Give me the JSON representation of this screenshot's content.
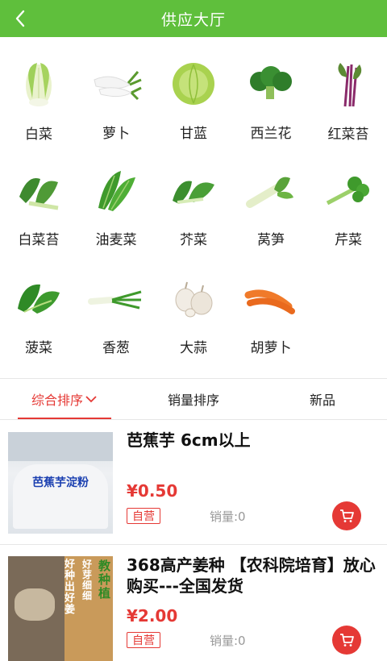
{
  "header": {
    "title": "供应大厅",
    "back_icon": "back-arrow-icon"
  },
  "categories": [
    {
      "name": "白菜",
      "icon": "napa-cabbage-icon"
    },
    {
      "name": "萝卜",
      "icon": "radish-icon"
    },
    {
      "name": "甘蓝",
      "icon": "cabbage-icon"
    },
    {
      "name": "西兰花",
      "icon": "broccoli-icon"
    },
    {
      "name": "红菜苔",
      "icon": "red-cabbage-stem-icon"
    },
    {
      "name": "白菜苔",
      "icon": "bok-choy-stem-icon"
    },
    {
      "name": "油麦菜",
      "icon": "lettuce-leaf-icon"
    },
    {
      "name": "芥菜",
      "icon": "mustard-greens-icon"
    },
    {
      "name": "莴笋",
      "icon": "celtuce-icon"
    },
    {
      "name": "芹菜",
      "icon": "celery-icon"
    },
    {
      "name": "菠菜",
      "icon": "spinach-icon"
    },
    {
      "name": "香葱",
      "icon": "scallion-icon"
    },
    {
      "name": "大蒜",
      "icon": "garlic-icon"
    },
    {
      "name": "胡萝卜",
      "icon": "carrot-icon"
    }
  ],
  "sort_tabs": [
    {
      "label": "综合排序",
      "active": true,
      "icon": "chevron-down-icon"
    },
    {
      "label": "销量排序",
      "active": false
    },
    {
      "label": "新品",
      "active": false
    }
  ],
  "products": [
    {
      "name": "芭蕉芋 6cm以上",
      "price": "¥0.50",
      "badge": "自营",
      "sales": "销量:0",
      "image_text": "芭蕉芋淀粉"
    },
    {
      "name": "368高产姜种 【农科院培育】放心购买---全国发货",
      "price": "¥2.00",
      "badge": "自营",
      "sales": "销量:0",
      "image_text_1": "好种出好姜",
      "image_text_2": "教种植",
      "image_text_3": "好芽细细"
    }
  ],
  "colors": {
    "header_green": "#5fbf3c",
    "accent_red": "#e53935"
  }
}
